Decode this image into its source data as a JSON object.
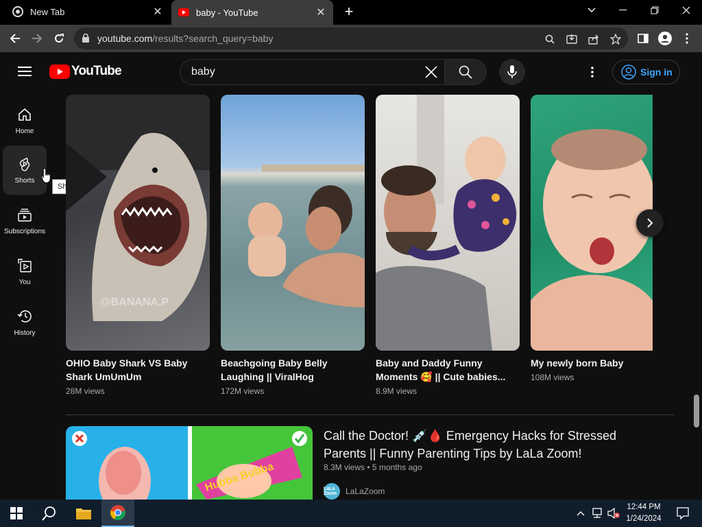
{
  "browser": {
    "tabs": [
      {
        "title": "New Tab",
        "active": false
      },
      {
        "title": "baby - YouTube",
        "active": true
      }
    ],
    "url_host": "youtube.com",
    "url_path": "/results?search_query=baby"
  },
  "youtube": {
    "logo_text": "YouTube",
    "search_query": "baby",
    "signin_label": "Sign in",
    "guide": [
      {
        "label": "Home",
        "icon": "home-icon"
      },
      {
        "label": "Shorts",
        "icon": "shorts-icon"
      },
      {
        "label": "Subscriptions",
        "icon": "subscriptions-icon"
      },
      {
        "label": "You",
        "icon": "you-icon"
      },
      {
        "label": "History",
        "icon": "history-icon"
      }
    ],
    "tooltip": "Shorts",
    "shorts": [
      {
        "title_line1": "OHIO Baby Shark VS Baby",
        "title_line2": "Shark UmUmUm",
        "views": "28M views",
        "watermark": "@BANANA.P"
      },
      {
        "title_line1": "Beachgoing Baby Belly",
        "title_line2": "Laughing || ViralHog",
        "views": "172M views"
      },
      {
        "title_line1": "Baby and Daddy Funny",
        "title_line2": "Moments 🥰 || Cute babies...",
        "views": "8.9M views"
      },
      {
        "title_line1": "My newly born Baby",
        "title_line2": "",
        "views": "108M views"
      }
    ],
    "video": {
      "title": "Call the Doctor! 💉🩸 Emergency Hacks for Stressed Parents || Funny Parenting Tips by LaLa Zoom!",
      "views": "8.3M views",
      "age": "5 months ago",
      "channel": "LaLaZoom",
      "channel_avatar_text": "LaLa Zoom",
      "gum_label": "Hubba Bubba"
    }
  },
  "taskbar": {
    "time": "12:44 PM",
    "date": "1/24/2024"
  },
  "colors": {
    "yt_red": "#ff0000",
    "link_blue": "#3ea6ff",
    "bg": "#0f0f0f"
  }
}
